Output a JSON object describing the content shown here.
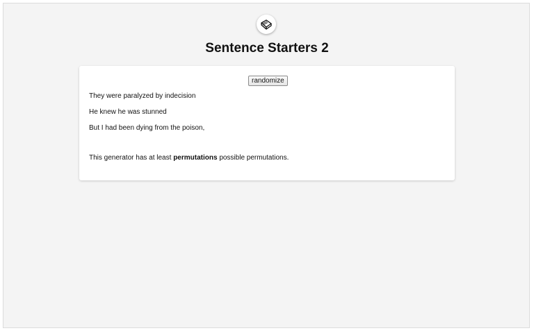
{
  "header": {
    "logo_icon": "book-icon",
    "title": "Sentence Starters 2"
  },
  "generator": {
    "randomize_label": "randomize",
    "sentences": [
      "They were paralyzed by indecision",
      "He knew he was stunned",
      "But I had been dying from the poison,"
    ],
    "footnote": {
      "prefix": "This generator has at least",
      "count": "permutations",
      "suffix": "possible permutations."
    }
  }
}
